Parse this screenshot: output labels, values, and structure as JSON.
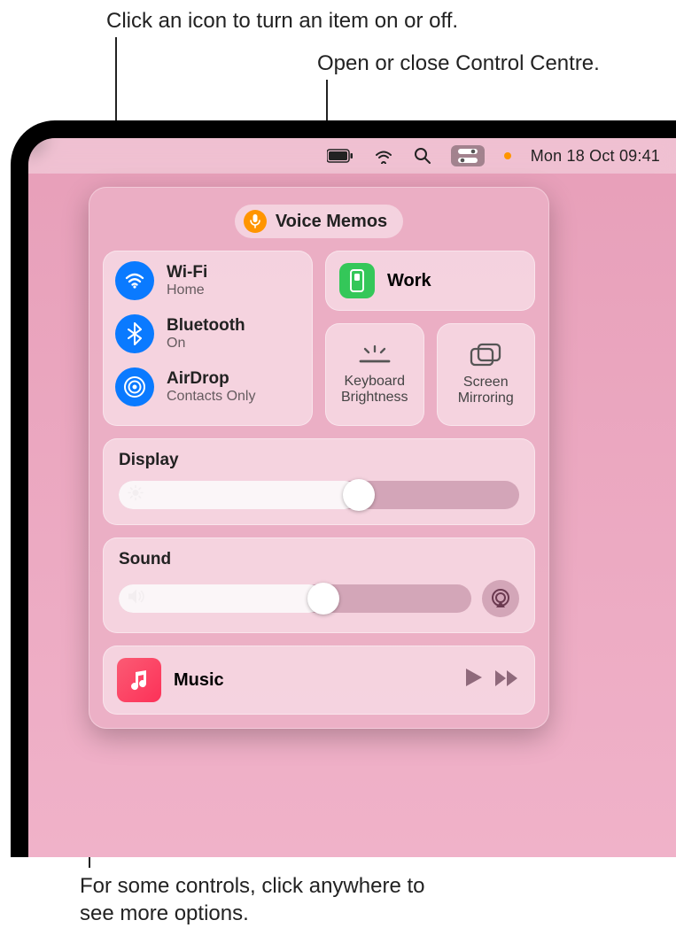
{
  "callouts": {
    "toggle": "Click an icon to turn an item on or off.",
    "openclose": "Open or close Control Centre.",
    "moreoptions": "For some controls, click anywhere to see more options."
  },
  "menubar": {
    "datetime": "Mon 18 Oct  09:41"
  },
  "voice_memos": {
    "label": "Voice Memos"
  },
  "connectivity": {
    "wifi": {
      "title": "Wi-Fi",
      "subtitle": "Home"
    },
    "bluetooth": {
      "title": "Bluetooth",
      "subtitle": "On"
    },
    "airdrop": {
      "title": "AirDrop",
      "subtitle": "Contacts Only"
    }
  },
  "focus": {
    "label": "Work"
  },
  "mini": {
    "keyboard": "Keyboard Brightness",
    "mirror": "Screen Mirroring"
  },
  "display": {
    "label": "Display",
    "value_pct": 60
  },
  "sound": {
    "label": "Sound",
    "value_pct": 58
  },
  "media": {
    "title": "Music"
  },
  "colors": {
    "accent_blue": "#0a7aff",
    "accent_green": "#34c759",
    "accent_orange": "#ff9500"
  }
}
